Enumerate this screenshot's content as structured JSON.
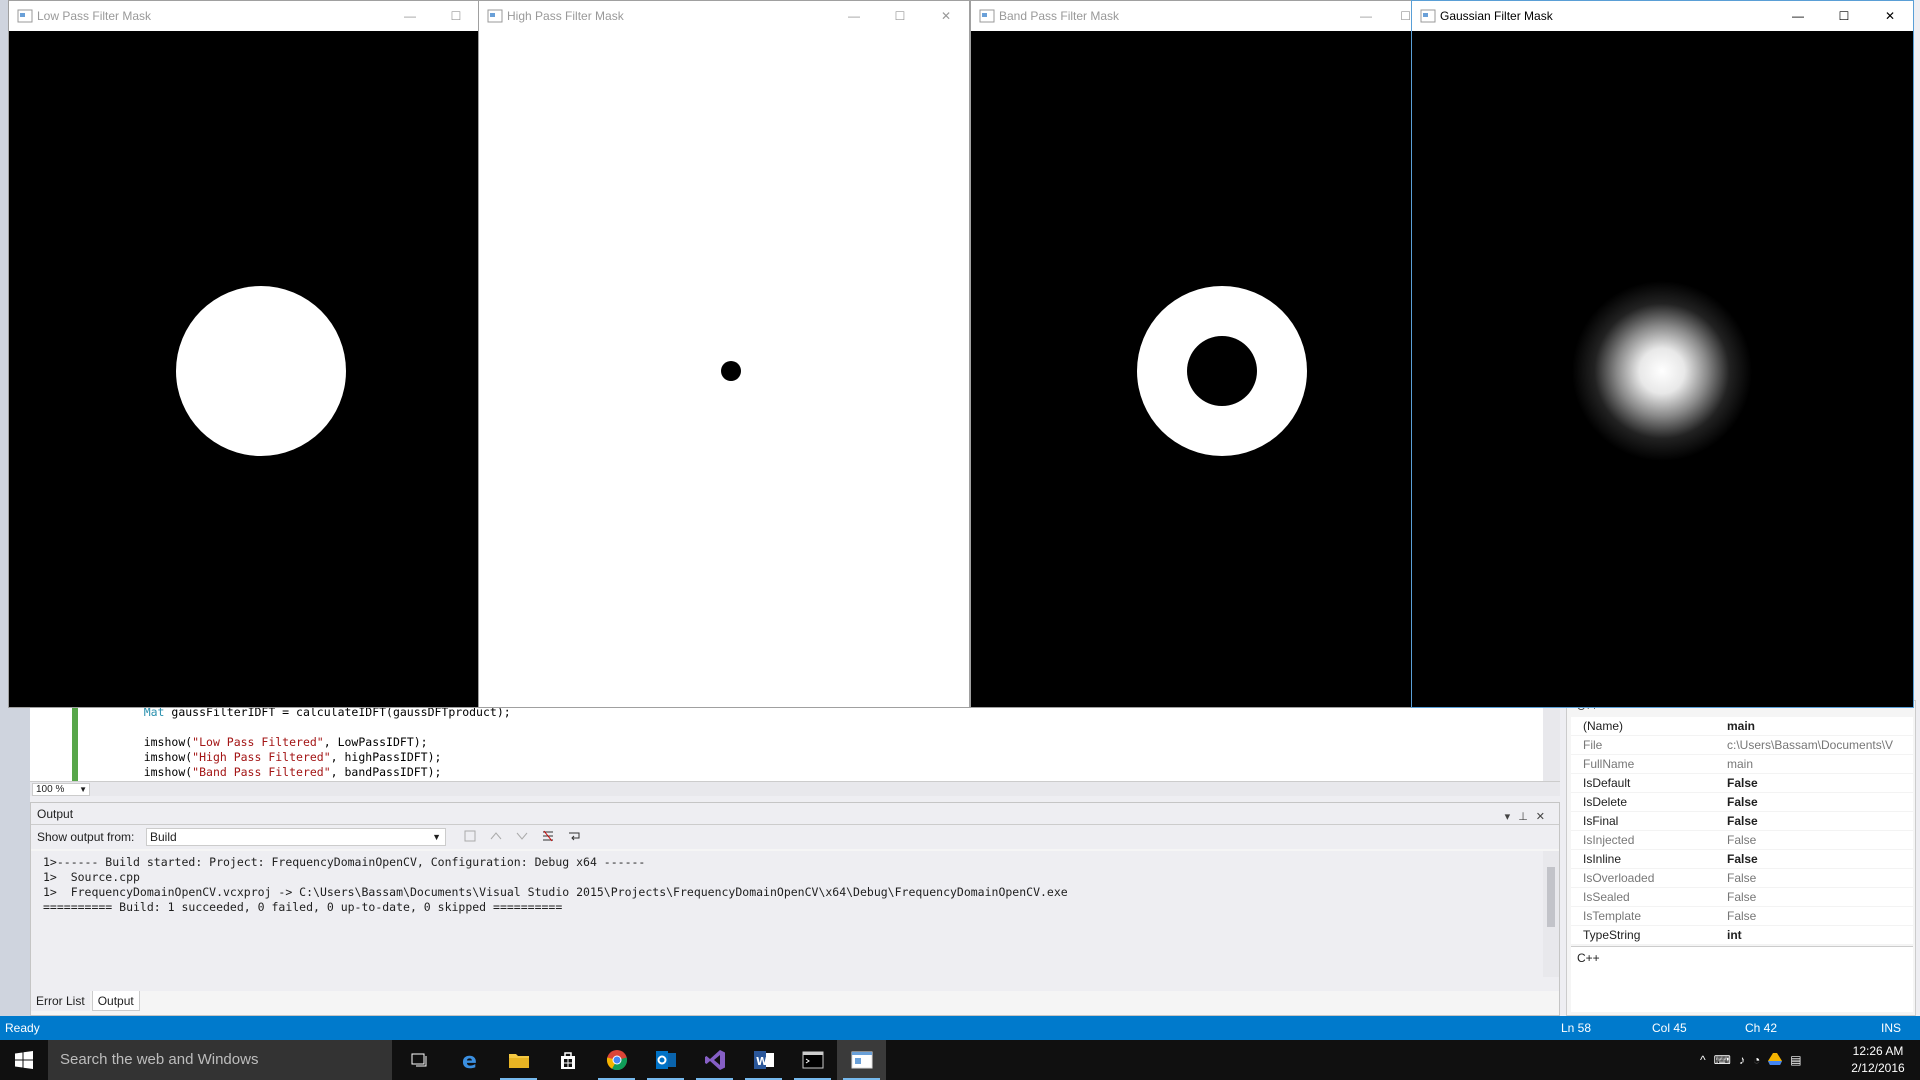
{
  "editor": {
    "zoom": "100 %",
    "lines": [
      {
        "indent": "    ",
        "type": "Mat",
        "rest": " gaussFilterIDFT = calculateIDFT(gaussDFTproduct);"
      },
      {
        "indent": "",
        "type": "",
        "rest": ""
      },
      {
        "indent": "    ",
        "fn": "imshow(",
        "str": "\"Low Pass Filtered\"",
        "tail": ", LowPassIDFT);"
      },
      {
        "indent": "    ",
        "fn": "imshow(",
        "str": "\"High Pass Filtered\"",
        "tail": ", highPassIDFT);"
      },
      {
        "indent": "    ",
        "fn": "imshow(",
        "str": "\"Band Pass Filtered\"",
        "tail": ", bandPassIDFT);"
      }
    ]
  },
  "output": {
    "title": "Output",
    "show_output_label": "Show output from:",
    "show_output_value": "Build",
    "lines": [
      "1>------ Build started: Project: FrequencyDomainOpenCV, Configuration: Debug x64 ------",
      "1>  Source.cpp",
      "1>  FrequencyDomainOpenCV.vcxproj -> C:\\Users\\Bassam\\Documents\\Visual Studio 2015\\Projects\\FrequencyDomainOpenCV\\x64\\Debug\\FrequencyDomainOpenCV.exe",
      "========== Build: 1 succeeded, 0 failed, 0 up-to-date, 0 skipped =========="
    ],
    "tabs": [
      "Error List",
      "Output"
    ],
    "active_tab": "Output"
  },
  "properties": {
    "header": "C++",
    "rows": [
      {
        "name": "(Name)",
        "value": "main",
        "bold": true,
        "dim": false
      },
      {
        "name": "File",
        "value": "c:\\Users\\Bassam\\Documents\\V",
        "bold": false,
        "dim": true
      },
      {
        "name": "FullName",
        "value": "main",
        "bold": false,
        "dim": true
      },
      {
        "name": "IsDefault",
        "value": "False",
        "bold": true,
        "dim": false
      },
      {
        "name": "IsDelete",
        "value": "False",
        "bold": true,
        "dim": false
      },
      {
        "name": "IsFinal",
        "value": "False",
        "bold": true,
        "dim": false
      },
      {
        "name": "IsInjected",
        "value": "False",
        "bold": false,
        "dim": true
      },
      {
        "name": "IsInline",
        "value": "False",
        "bold": true,
        "dim": false
      },
      {
        "name": "IsOverloaded",
        "value": "False",
        "bold": false,
        "dim": true
      },
      {
        "name": "IsSealed",
        "value": "False",
        "bold": false,
        "dim": true
      },
      {
        "name": "IsTemplate",
        "value": "False",
        "bold": false,
        "dim": true
      },
      {
        "name": "TypeString",
        "value": "int",
        "bold": true,
        "dim": false
      }
    ],
    "description": "C++"
  },
  "status": {
    "text": "Ready",
    "ln": "Ln 58",
    "col": "Col 45",
    "ch": "Ch 42",
    "mode": "INS"
  },
  "windows": {
    "low_pass": {
      "title": "Low Pass Filter Mask"
    },
    "high_pass": {
      "title": "High Pass Filter Mask"
    },
    "band_pass": {
      "title": "Band Pass Filter Mask"
    },
    "gaussian": {
      "title": "Gaussian Filter Mask"
    }
  },
  "taskbar": {
    "search_placeholder": "Search the web and Windows",
    "icons": [
      "task-view-icon",
      "edge-icon",
      "file-explorer-icon",
      "store-icon",
      "chrome-icon",
      "outlook-icon",
      "visual-studio-icon",
      "word-icon",
      "terminal-icon",
      "opencv-window-icon"
    ],
    "time": "12:26 AM",
    "date": "2/12/2016"
  },
  "colors": {
    "statusbar": "#007acc",
    "taskbar": "#101010",
    "accent": "#76b9ed"
  }
}
